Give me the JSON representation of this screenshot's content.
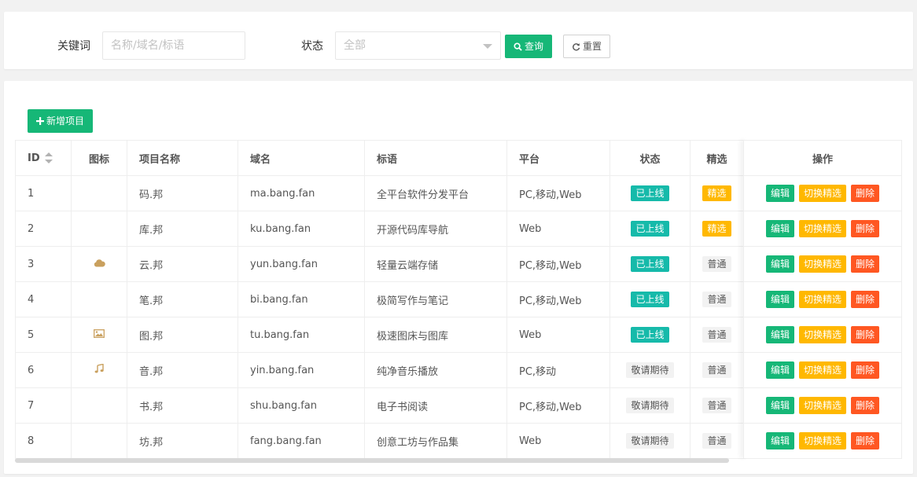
{
  "search": {
    "keyword_label": "关键词",
    "keyword_placeholder": "名称/域名/标语",
    "status_label": "状态",
    "status_selected": "全部",
    "query_label": "查询",
    "reset_label": "重置"
  },
  "toolbar": {
    "add_label": "新增项目"
  },
  "table": {
    "headers": {
      "id": "ID",
      "icon": "图标",
      "name": "项目名称",
      "domain": "域名",
      "slogan": "标语",
      "platform": "平台",
      "status": "状态",
      "featured": "精选",
      "actions": "操作"
    },
    "action_labels": {
      "edit": "编辑",
      "toggle": "切换精选",
      "delete": "删除"
    },
    "rows": [
      {
        "id": "1",
        "icon": "",
        "name": "码.邦",
        "domain": "ma.bang.fan",
        "slogan": "全平台软件分发平台",
        "platform": "PC,移动,Web",
        "status": "已上线",
        "featured": "精选"
      },
      {
        "id": "2",
        "icon": "",
        "name": "库.邦",
        "domain": "ku.bang.fan",
        "slogan": "开源代码库导航",
        "platform": "Web",
        "status": "已上线",
        "featured": "精选"
      },
      {
        "id": "3",
        "icon": "cloud-icon",
        "name": "云.邦",
        "domain": "yun.bang.fan",
        "slogan": "轻量云端存储",
        "platform": "PC,移动,Web",
        "status": "已上线",
        "featured": "普通"
      },
      {
        "id": "4",
        "icon": "",
        "name": "笔.邦",
        "domain": "bi.bang.fan",
        "slogan": "极简写作与笔记",
        "platform": "PC,移动,Web",
        "status": "已上线",
        "featured": "普通"
      },
      {
        "id": "5",
        "icon": "image-icon",
        "name": "图.邦",
        "domain": "tu.bang.fan",
        "slogan": "极速图床与图库",
        "platform": "Web",
        "status": "已上线",
        "featured": "普通"
      },
      {
        "id": "6",
        "icon": "music-icon",
        "name": "音.邦",
        "domain": "yin.bang.fan",
        "slogan": "纯净音乐播放",
        "platform": "PC,移动",
        "status": "敬请期待",
        "featured": "普通"
      },
      {
        "id": "7",
        "icon": "",
        "name": "书.邦",
        "domain": "shu.bang.fan",
        "slogan": "电子书阅读",
        "platform": "PC,移动,Web",
        "status": "敬请期待",
        "featured": "普通"
      },
      {
        "id": "8",
        "icon": "",
        "name": "坊.邦",
        "domain": "fang.bang.fan",
        "slogan": "创意工坊与作品集",
        "platform": "Web",
        "status": "敬请期待",
        "featured": "普通"
      }
    ]
  },
  "colors": {
    "primary": "#16b777",
    "online": "#16baaa",
    "featured": "#ffb800",
    "danger": "#ff5722",
    "icon": "#c9a05e"
  }
}
